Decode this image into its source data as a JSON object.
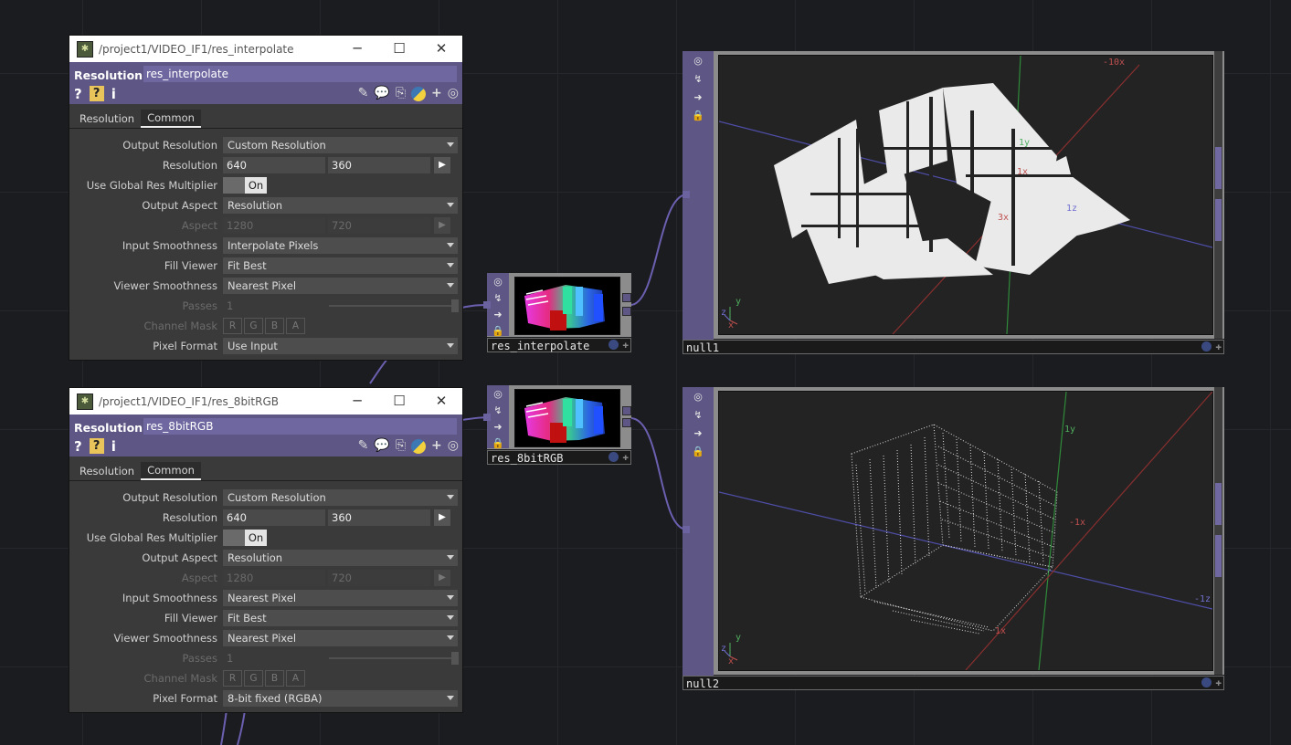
{
  "colors": {
    "accent": "#5e5684",
    "wire": "#6b5fb0",
    "background": "#1b1c20"
  },
  "windows": [
    {
      "title": "/project1/VIDEO_IF1/res_interpolate",
      "op_type": "Resolution",
      "op_name": "res_interpolate",
      "tabs": [
        "Resolution",
        "Common"
      ],
      "active_tab": "Common",
      "params": {
        "output_resolution": {
          "label": "Output Resolution",
          "value": "Custom Resolution"
        },
        "resolution": {
          "label": "Resolution",
          "w": "640",
          "h": "360"
        },
        "use_global": {
          "label": "Use Global Res Multiplier",
          "value": "On"
        },
        "output_aspect": {
          "label": "Output Aspect",
          "value": "Resolution"
        },
        "aspect": {
          "label": "Aspect",
          "w": "1280",
          "h": "720"
        },
        "input_smoothness": {
          "label": "Input Smoothness",
          "value": "Interpolate Pixels"
        },
        "fill_viewer": {
          "label": "Fill Viewer",
          "value": "Fit Best"
        },
        "viewer_smoothness": {
          "label": "Viewer Smoothness",
          "value": "Nearest Pixel"
        },
        "passes": {
          "label": "Passes",
          "value": "1"
        },
        "channel_mask": {
          "label": "Channel Mask",
          "channels": [
            "R",
            "G",
            "B",
            "A"
          ]
        },
        "pixel_format": {
          "label": "Pixel Format",
          "value": "Use Input"
        }
      }
    },
    {
      "title": "/project1/VIDEO_IF1/res_8bitRGB",
      "op_type": "Resolution",
      "op_name": "res_8bitRGB",
      "tabs": [
        "Resolution",
        "Common"
      ],
      "active_tab": "Common",
      "params": {
        "output_resolution": {
          "label": "Output Resolution",
          "value": "Custom Resolution"
        },
        "resolution": {
          "label": "Resolution",
          "w": "640",
          "h": "360"
        },
        "use_global": {
          "label": "Use Global Res Multiplier",
          "value": "On"
        },
        "output_aspect": {
          "label": "Output Aspect",
          "value": "Resolution"
        },
        "aspect": {
          "label": "Aspect",
          "w": "1280",
          "h": "720"
        },
        "input_smoothness": {
          "label": "Input Smoothness",
          "value": "Nearest Pixel"
        },
        "fill_viewer": {
          "label": "Fill Viewer",
          "value": "Fit Best"
        },
        "viewer_smoothness": {
          "label": "Viewer Smoothness",
          "value": "Nearest Pixel"
        },
        "passes": {
          "label": "Passes",
          "value": "1"
        },
        "channel_mask": {
          "label": "Channel Mask",
          "channels": [
            "R",
            "G",
            "B",
            "A"
          ]
        },
        "pixel_format": {
          "label": "Pixel Format",
          "value": "8-bit fixed (RGBA)"
        }
      }
    }
  ],
  "nodes": {
    "res_interpolate": {
      "name": "res_interpolate"
    },
    "res_8bitRGB": {
      "name": "res_8bitRGB"
    },
    "null1": {
      "name": "null1",
      "axis_labels": {
        "neg_x_far": "-10x",
        "y": "1y",
        "x": "1x",
        "z_mid": "1z",
        "x3": "3x",
        "mini_y": "y",
        "mini_z": "z",
        "mini_x": "x"
      }
    },
    "null2": {
      "name": "null2",
      "axis_labels": {
        "y": "1y",
        "neg_x": "-1x",
        "neg_z": "-1z",
        "x": "1x",
        "mini_y": "y",
        "mini_z": "z",
        "mini_x": "x"
      }
    }
  }
}
